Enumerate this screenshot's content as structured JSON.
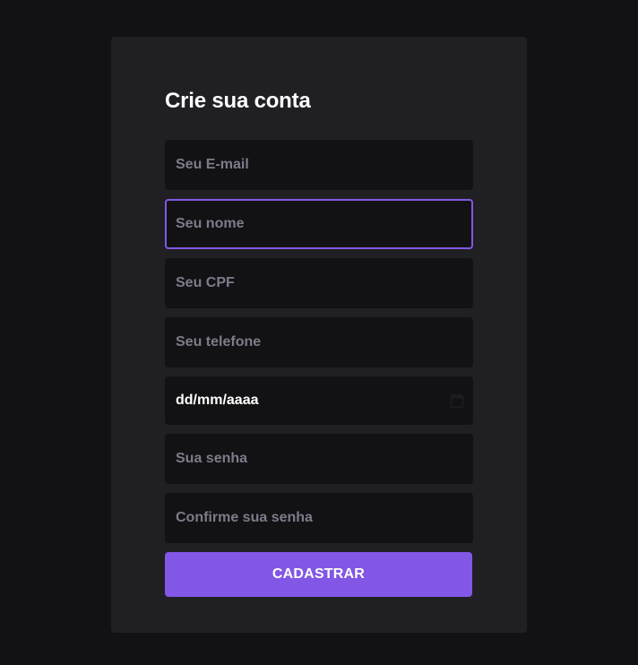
{
  "form": {
    "title": "Crie sua conta",
    "fields": [
      {
        "placeholder": "Seu E-mail",
        "value": ""
      },
      {
        "placeholder": "Seu nome",
        "value": ""
      },
      {
        "placeholder": "Seu CPF",
        "value": ""
      },
      {
        "placeholder": "Seu telefone",
        "value": ""
      },
      {
        "placeholder": "dd/mm/aaaa",
        "value": ""
      },
      {
        "placeholder": "Sua senha",
        "value": ""
      },
      {
        "placeholder": "Confirme sua senha",
        "value": ""
      }
    ],
    "submit_label": "CADASTRAR"
  },
  "icons": {
    "date": "calendar-icon"
  },
  "colors": {
    "page_background": "#121214",
    "card_background": "#202024",
    "input_background": "#121214",
    "accent": "#8257e5",
    "placeholder": "#7c7c8a",
    "text": "#ffffff"
  }
}
